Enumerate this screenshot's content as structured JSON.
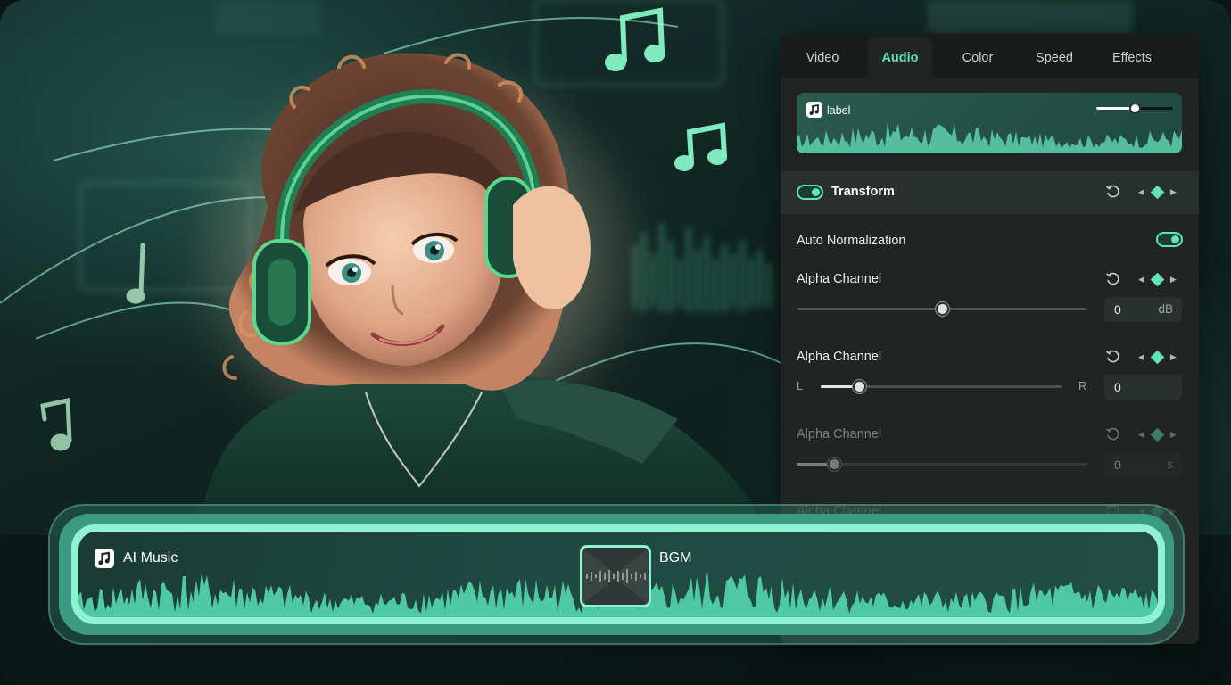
{
  "tabs": [
    {
      "label": "Video",
      "active": false
    },
    {
      "label": "Audio",
      "active": true
    },
    {
      "label": "Color",
      "active": false
    },
    {
      "label": "Speed",
      "active": false
    },
    {
      "label": "Effects",
      "active": false
    }
  ],
  "clip_preview": {
    "label": "label",
    "icon": "music-note-icon",
    "volume_level": 0.5
  },
  "transform": {
    "title": "Transform",
    "enabled": true
  },
  "auto_normalization": {
    "label": "Auto Normalization",
    "enabled": true
  },
  "channels": [
    {
      "label": "Alpha Channel",
      "value": "0",
      "unit": "dB",
      "level": 0.5
    },
    {
      "label": "Alpha Channel",
      "value": "0",
      "left": "L",
      "right": "R",
      "level": 0.16
    },
    {
      "label": "Alpha Channel",
      "value": "0",
      "unit": "s",
      "level": 0.13
    },
    {
      "label": "Alpha Channel"
    }
  ],
  "timeline": {
    "clip1_name": "AI Music",
    "clip2_name": "BGM",
    "icon": "music-note-icon"
  },
  "colors": {
    "accent": "#5fe3bd",
    "panel_bg": "#202524",
    "track_border": "#8ff2d2"
  }
}
